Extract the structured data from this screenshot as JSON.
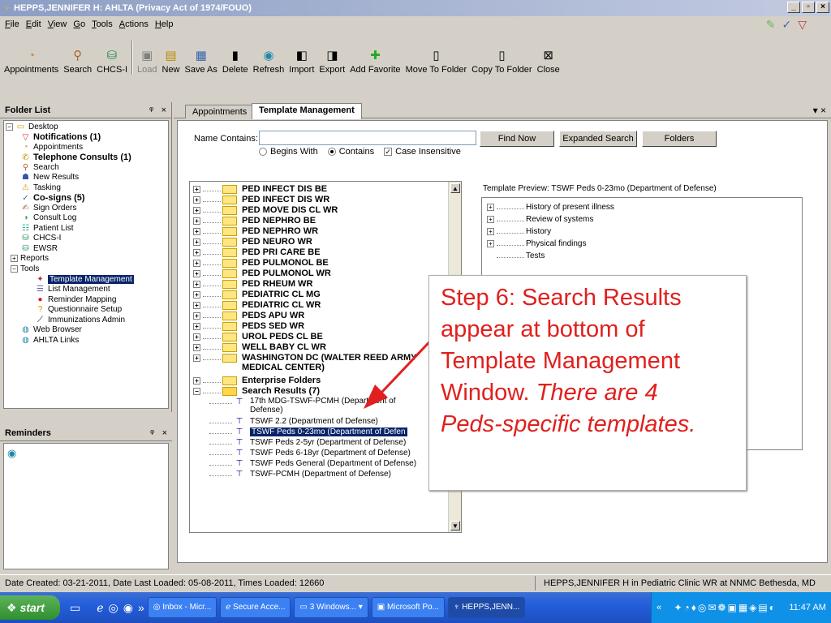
{
  "window": {
    "title": "HEPPS,JENNIFER H: AHLTA  (Privacy Act of 1974/FOUO)",
    "controls": [
      "_",
      "▫",
      "×"
    ]
  },
  "menu": [
    "File",
    "Edit",
    "View",
    "Go",
    "Tools",
    "Actions",
    "Help"
  ],
  "toolbar": {
    "nav": [
      {
        "label": "Appointments",
        "icon": "appointments-icon"
      },
      {
        "label": "Search",
        "icon": "search-icon"
      },
      {
        "label": "CHCS-I",
        "icon": "chcs-icon"
      }
    ],
    "actions": [
      {
        "label": "Load",
        "icon": "load-icon",
        "disabled": true
      },
      {
        "label": "New",
        "icon": "new-icon"
      },
      {
        "label": "Save As",
        "icon": "save-icon"
      },
      {
        "label": "Delete",
        "icon": "delete-icon"
      },
      {
        "label": "Refresh",
        "icon": "refresh-icon"
      },
      {
        "label": "Import",
        "icon": "import-icon"
      },
      {
        "label": "Export",
        "icon": "export-icon"
      },
      {
        "label": "Add Favorite",
        "icon": "add-favorite-icon"
      },
      {
        "label": "Move To Folder",
        "icon": "move-folder-icon"
      },
      {
        "label": "Copy To Folder",
        "icon": "copy-folder-icon"
      },
      {
        "label": "Close",
        "icon": "close-icon"
      }
    ]
  },
  "folder_list": {
    "title": "Folder List",
    "pin": "ᵠ",
    "close": "×",
    "items": [
      {
        "label": "Desktop",
        "bold": false
      },
      {
        "label": "Notifications (1)",
        "bold": true
      },
      {
        "label": "Appointments",
        "bold": false
      },
      {
        "label": "Telephone Consults (1)",
        "bold": true
      },
      {
        "label": "Search",
        "bold": false
      },
      {
        "label": "New Results",
        "bold": false
      },
      {
        "label": "Tasking",
        "bold": false
      },
      {
        "label": "Co-signs (5)",
        "bold": true
      },
      {
        "label": "Sign Orders",
        "bold": false
      },
      {
        "label": "Consult Log",
        "bold": false
      },
      {
        "label": "Patient List",
        "bold": false
      },
      {
        "label": "CHCS-I",
        "bold": false
      },
      {
        "label": "EWSR",
        "bold": false
      },
      {
        "label": "Reports",
        "bold": false
      },
      {
        "label": "Tools",
        "bold": false
      },
      {
        "label": "Template Management",
        "bold": false
      },
      {
        "label": "List Management",
        "bold": false
      },
      {
        "label": "Reminder Mapping",
        "bold": false
      },
      {
        "label": "Questionnaire Setup",
        "bold": false
      },
      {
        "label": "Immunizations Admin",
        "bold": false
      },
      {
        "label": "Web Browser",
        "bold": false
      },
      {
        "label": "AHLTA Links",
        "bold": false
      }
    ]
  },
  "reminders": {
    "title": "Reminders",
    "pin": "ᵠ",
    "close": "×"
  },
  "tabs": [
    {
      "label": "Appointments",
      "active": false
    },
    {
      "label": "Template Management",
      "active": true
    }
  ],
  "tab_controls": "▾ ×",
  "search_form": {
    "name_label": "Name Contains:",
    "name_value": "",
    "begins_with": "Begins With",
    "contains": "Contains",
    "case_insensitive": "Case Insensitive",
    "find_now": "Find Now",
    "expanded_search": "Expanded Search",
    "folders": "Folders"
  },
  "template_tree": {
    "folders": [
      "PED INFECT DIS BE",
      "PED INFECT DIS WR",
      "PED MOVE DIS CL WR",
      "PED NEPHRO BE",
      "PED NEPHRO WR",
      "PED NEURO WR",
      "PED PRI CARE BE",
      "PED PULMONOL BE",
      "PED PULMONOL WR",
      "PED RHEUM WR",
      "PEDIATRIC CL MG",
      "PEDIATRIC CL WR",
      "PEDS APU WR",
      "PEDS SED WR",
      "UROL PEDS CL BE",
      "WELL BABY CL WR"
    ],
    "washington_line1": "WASHINGTON DC  (WALTER REED ARMY",
    "washington_line2": "MEDICAL CENTER)",
    "enterprise": "Enterprise Folders",
    "search_results": "Search Results (7)",
    "results": [
      {
        "label": "17th MDG-TSWF-PCMH    (Department of",
        "label2": "Defense)",
        "selected": false
      },
      {
        "label": "TSWF 2.2    (Department of Defense)",
        "selected": false
      },
      {
        "label": "TSWF Peds 0-23mo    (Department of Defen",
        "selected": true
      },
      {
        "label": "TSWF Peds 2-5yr    (Department of Defense)",
        "selected": false
      },
      {
        "label": "TSWF Peds 6-18yr    (Department of Defense)",
        "selected": false
      },
      {
        "label": "TSWF Peds General    (Department of Defense)",
        "selected": false
      },
      {
        "label": "TSWF-PCMH    (Department of Defense)",
        "selected": false
      }
    ]
  },
  "preview": {
    "label": "Template Preview: TSWF Peds 0-23mo    (Department of Defense)",
    "items": [
      "History of present illness",
      "Review of systems",
      "History",
      "Physical findings",
      "Tests"
    ]
  },
  "callout": {
    "line1": "Step 6: Search Results",
    "line2": "appear at bottom of",
    "line3": "Template Management",
    "line4a": "Window.  ",
    "line4b": "There are 4",
    "line5": "Peds-specific templates."
  },
  "status": {
    "left": "Date Created: 03-21-2011, Date Last Loaded: 05-08-2011, Times Loaded: 12660",
    "right": "HEPPS,JENNIFER H in Pediatric Clinic WR at NNMC Bethesda, MD"
  },
  "taskbar": {
    "start": "start",
    "more": "»",
    "tasks": [
      {
        "label": "Inbox - Micr..."
      },
      {
        "label": "Secure Acce..."
      },
      {
        "label": "3 Windows..."
      },
      {
        "label": "Microsoft Po..."
      },
      {
        "label": "HEPPS,JENN..."
      }
    ],
    "tray_arrow": "«",
    "clock": "11:47 AM"
  },
  "colors": {
    "accent": "#0a246a",
    "callout_text": "#e0201e",
    "arrow": "#e02020",
    "folder": "#ffe680"
  }
}
